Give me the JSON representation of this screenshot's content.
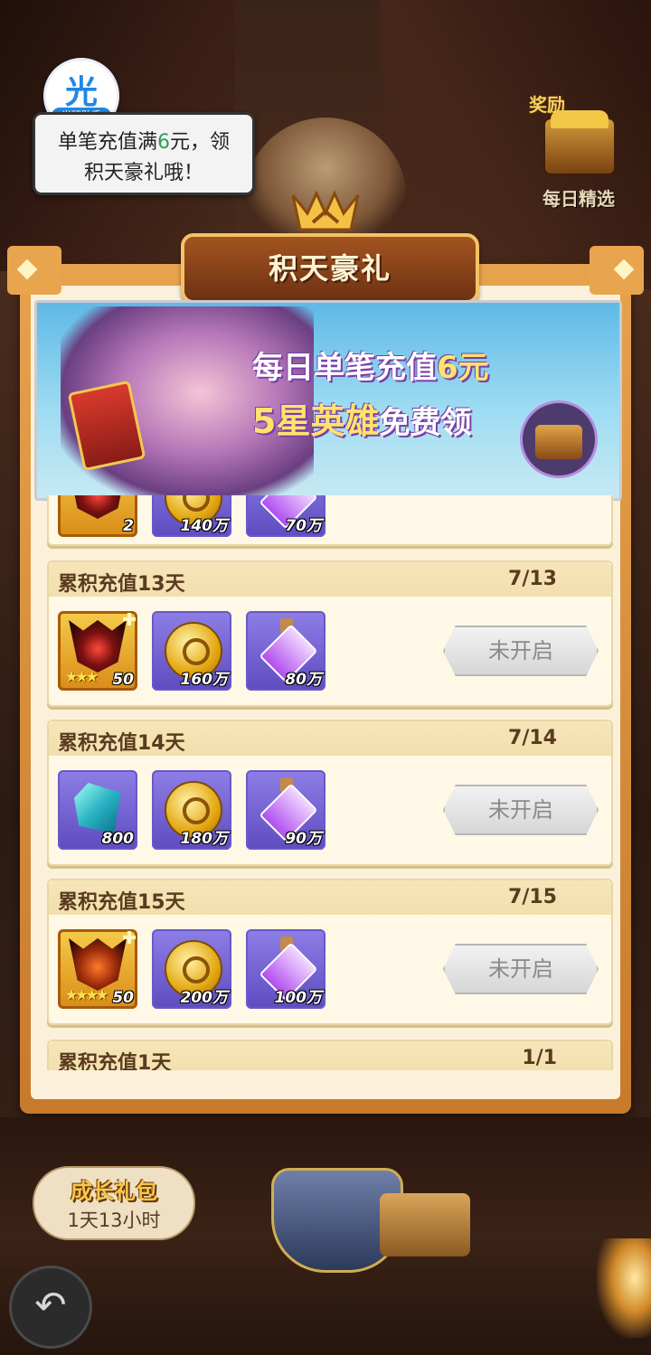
{
  "assistant": {
    "logo_glyph": "光",
    "logo_tag": "光环助手",
    "bubble_line1_pre": "单笔充值满",
    "bubble_line1_num": "6",
    "bubble_line1_post": "元，领",
    "bubble_line2": "积天豪礼哦！"
  },
  "reward": {
    "title": "奖励",
    "label": "每日精选"
  },
  "panel": {
    "title": "积天豪礼"
  },
  "banner": {
    "line1_pre": "每日单笔充值",
    "line1_num": "6元",
    "line2_main": "5星英雄",
    "line2_free": "免费领"
  },
  "rows": [
    {
      "title": "",
      "progress": "",
      "items": [
        {
          "type": "mask",
          "qty": "2"
        },
        {
          "type": "coin",
          "qty": "140万"
        },
        {
          "type": "potion",
          "qty": "70万"
        }
      ]
    },
    {
      "title": "累积充值13天",
      "progress": "7/13",
      "button": "未开启",
      "items": [
        {
          "type": "mask",
          "qty": "50"
        },
        {
          "type": "coin",
          "qty": "160万"
        },
        {
          "type": "potion",
          "qty": "80万"
        }
      ]
    },
    {
      "title": "累积充值14天",
      "progress": "7/14",
      "button": "未开启",
      "items": [
        {
          "type": "gem",
          "qty": "800"
        },
        {
          "type": "coin",
          "qty": "180万"
        },
        {
          "type": "potion",
          "qty": "90万"
        }
      ]
    },
    {
      "title": "累积充值15天",
      "progress": "7/15",
      "button": "未开启",
      "items": [
        {
          "type": "mask",
          "qty": "50"
        },
        {
          "type": "coin",
          "qty": "200万"
        },
        {
          "type": "potion",
          "qty": "100万"
        }
      ]
    },
    {
      "title": "累积充值1天",
      "progress": "1/1"
    }
  ],
  "bottom": {
    "growth_title": "成长礼包",
    "growth_timer": "1天13小时",
    "back_icon": "↶"
  }
}
